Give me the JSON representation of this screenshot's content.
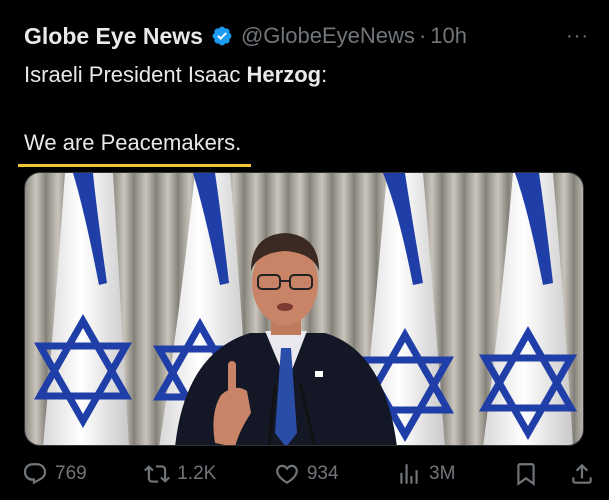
{
  "tweet": {
    "author_name": "Globe Eye News",
    "handle": "@GlobeEyeNews",
    "separator": "·",
    "time": "10h",
    "more_label": "···",
    "text_line1_prefix": "Israeli President Isaac ",
    "text_line1_bold": "Herzog",
    "text_line1_suffix": ":",
    "text_line3": "We are Peacemakers.",
    "highlight_color": "#f4c430",
    "verified_color": "#1d9bf0"
  },
  "actions": {
    "replies": "769",
    "reposts": "1.2K",
    "likes": "934",
    "views": "3M",
    "icons": [
      "reply-icon",
      "repost-icon",
      "like-icon",
      "views-icon",
      "bookmark-icon",
      "share-icon"
    ]
  }
}
